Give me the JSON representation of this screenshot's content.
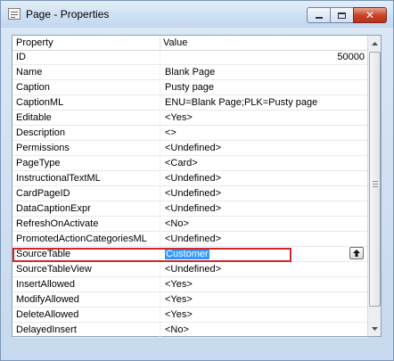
{
  "window": {
    "title": "Page - Properties",
    "controls": {
      "minimize": "minimize",
      "maximize": "maximize",
      "close": "close"
    }
  },
  "table": {
    "headers": {
      "property": "Property",
      "value": "Value"
    },
    "rows": [
      {
        "property": "ID",
        "value": "50000",
        "align": "right"
      },
      {
        "property": "Name",
        "value": "Blank Page"
      },
      {
        "property": "Caption",
        "value": "Pusty page"
      },
      {
        "property": "CaptionML",
        "value": "ENU=Blank Page;PLK=Pusty page"
      },
      {
        "property": "Editable",
        "value": "<Yes>"
      },
      {
        "property": "Description",
        "value": "<>"
      },
      {
        "property": "Permissions",
        "value": "<Undefined>"
      },
      {
        "property": "PageType",
        "value": "<Card>"
      },
      {
        "property": "InstructionalTextML",
        "value": "<Undefined>"
      },
      {
        "property": "CardPageID",
        "value": "<Undefined>"
      },
      {
        "property": "DataCaptionExpr",
        "value": "<Undefined>"
      },
      {
        "property": "RefreshOnActivate",
        "value": "<No>"
      },
      {
        "property": "PromotedActionCategoriesML",
        "value": "<Undefined>"
      },
      {
        "property": "SourceTable",
        "value": "Customer",
        "selected": true,
        "highlighted": true,
        "has_lookup": true
      },
      {
        "property": "SourceTableView",
        "value": "<Undefined>"
      },
      {
        "property": "InsertAllowed",
        "value": "<Yes>"
      },
      {
        "property": "ModifyAllowed",
        "value": "<Yes>"
      },
      {
        "property": "DeleteAllowed",
        "value": "<Yes>"
      },
      {
        "property": "DelayedInsert",
        "value": "<No>"
      }
    ]
  },
  "colors": {
    "selection": "#3399ff",
    "highlight_box": "#d0282a",
    "close_button": "#c9452a"
  }
}
